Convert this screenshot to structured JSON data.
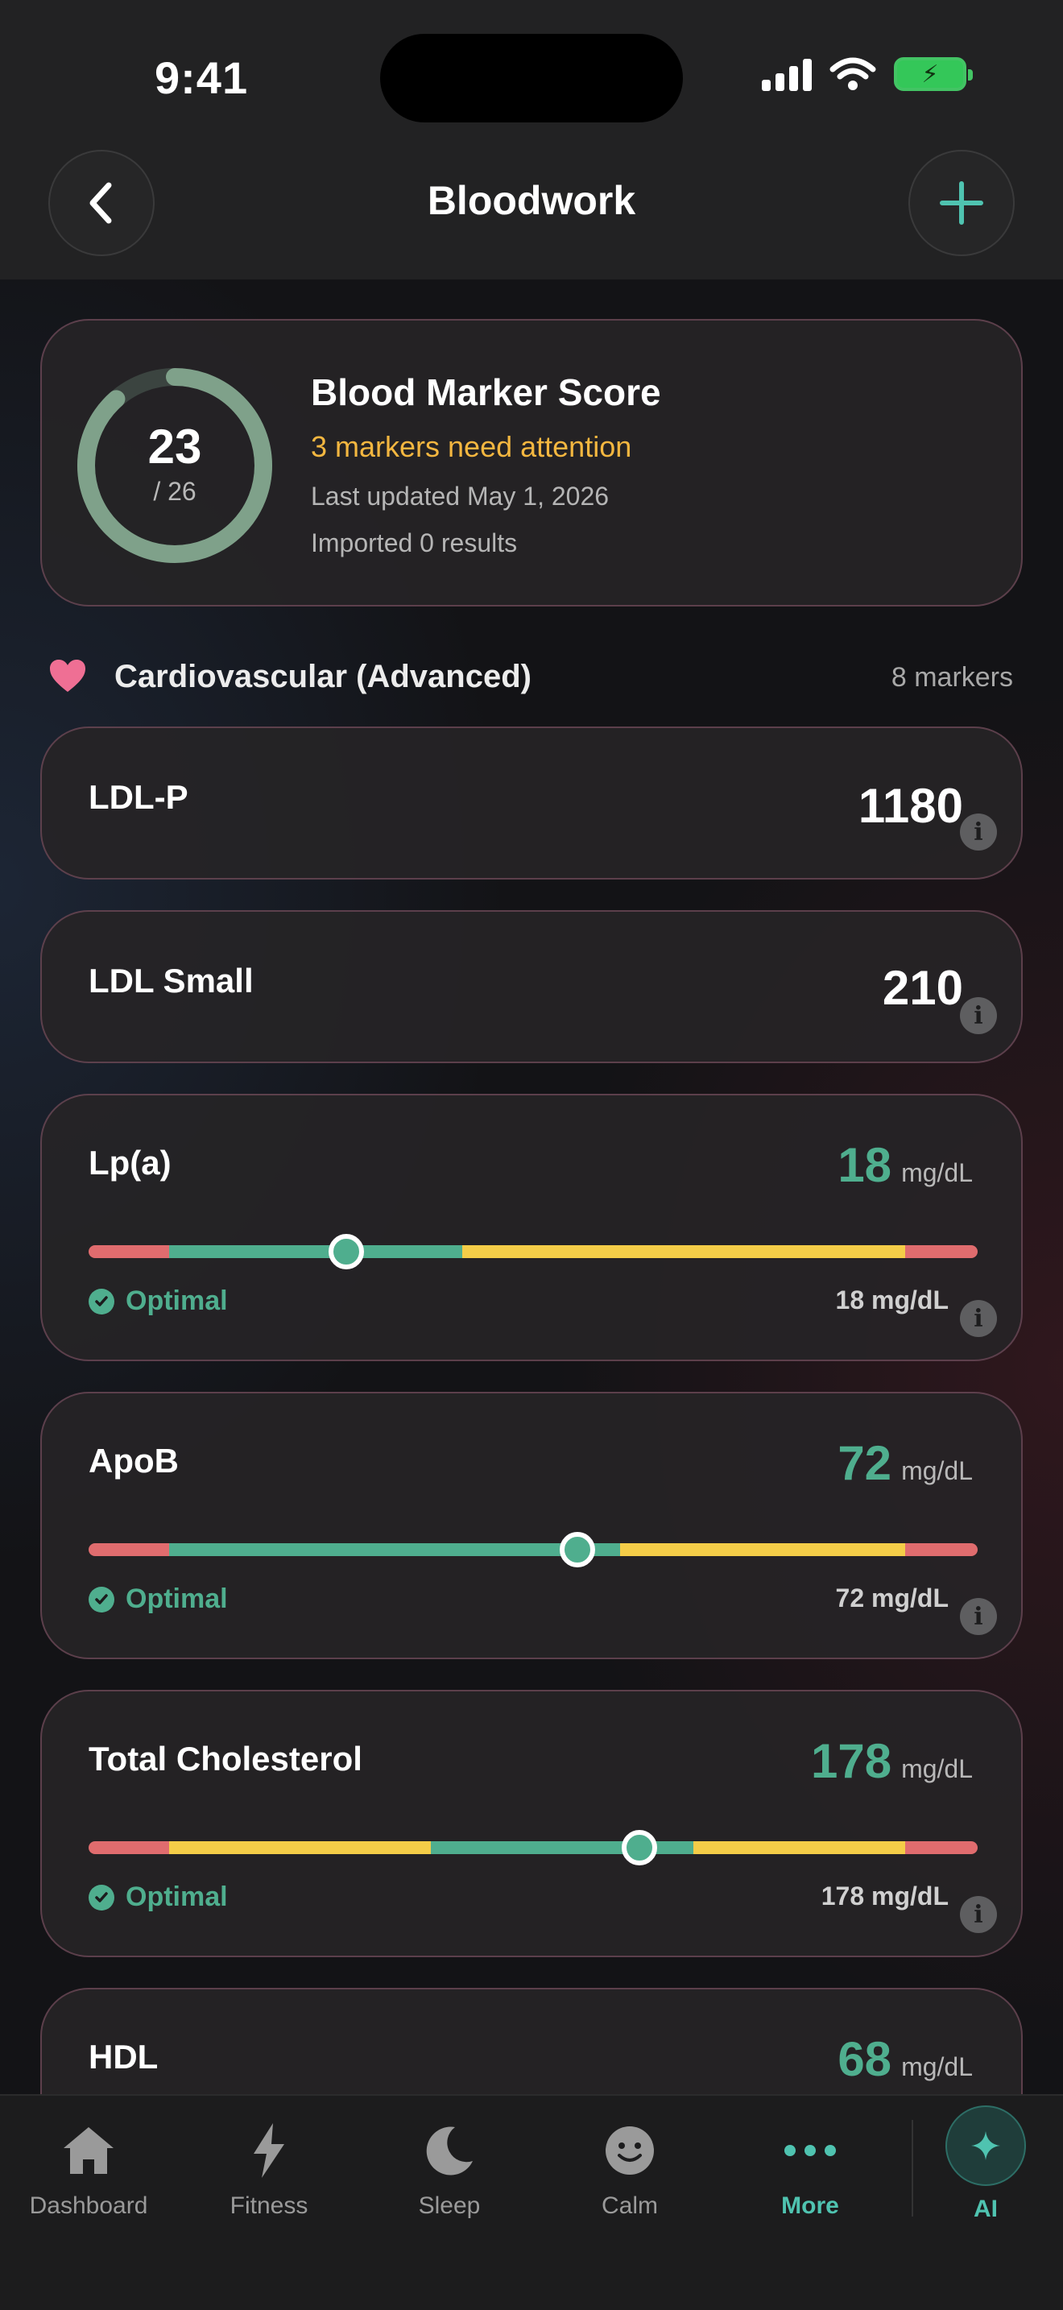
{
  "status_bar": {
    "time": "9:41"
  },
  "header": {
    "title": "Bloodwork",
    "back_icon": "chevron-left-icon",
    "add_icon": "plus-icon",
    "accent": "#4fc3b0"
  },
  "score": {
    "value": "23",
    "out_of": "/ 26",
    "fraction": 0.885,
    "title": "Blood Marker Score",
    "attention": "3 markers need attention",
    "updated": "Last updated May 1, 2026",
    "imported": "Imported 0 results"
  },
  "section": {
    "icon": "heart-icon",
    "title": "Cardiovascular (Advanced)",
    "count": "8 markers"
  },
  "markers": [
    {
      "name": "LDL-P",
      "value": "1180"
    },
    {
      "name": "LDL Small",
      "value": "210"
    },
    {
      "name": "Lp(a)",
      "value": "18",
      "unit": "mg/dL",
      "status": "Optimal",
      "reading": "18 mg/dL",
      "position": 0.29
    },
    {
      "name": "ApoB",
      "value": "72",
      "unit": "mg/dL",
      "status": "Optimal",
      "reading": "72 mg/dL",
      "position": 0.55
    },
    {
      "name": "Total Cholesterol",
      "value": "178",
      "unit": "mg/dL",
      "status": "Optimal",
      "reading": "178 mg/dL",
      "position": 0.62
    },
    {
      "name": "HDL",
      "value": "68",
      "unit": "mg/dL"
    }
  ],
  "colors": {
    "optimal": "#4fae8e",
    "warning": "#f4cd48",
    "critical": "#e06c6e",
    "attention": "#f4b740"
  },
  "tabs": [
    {
      "label": "Dashboard",
      "icon": "home-icon"
    },
    {
      "label": "Fitness",
      "icon": "lightning-icon"
    },
    {
      "label": "Sleep",
      "icon": "moon-icon"
    },
    {
      "label": "Calm",
      "icon": "smiley-icon"
    },
    {
      "label": "More",
      "icon": "more-dots-icon",
      "active": true
    },
    {
      "label": "AI",
      "icon": "sparkle-icon"
    }
  ]
}
